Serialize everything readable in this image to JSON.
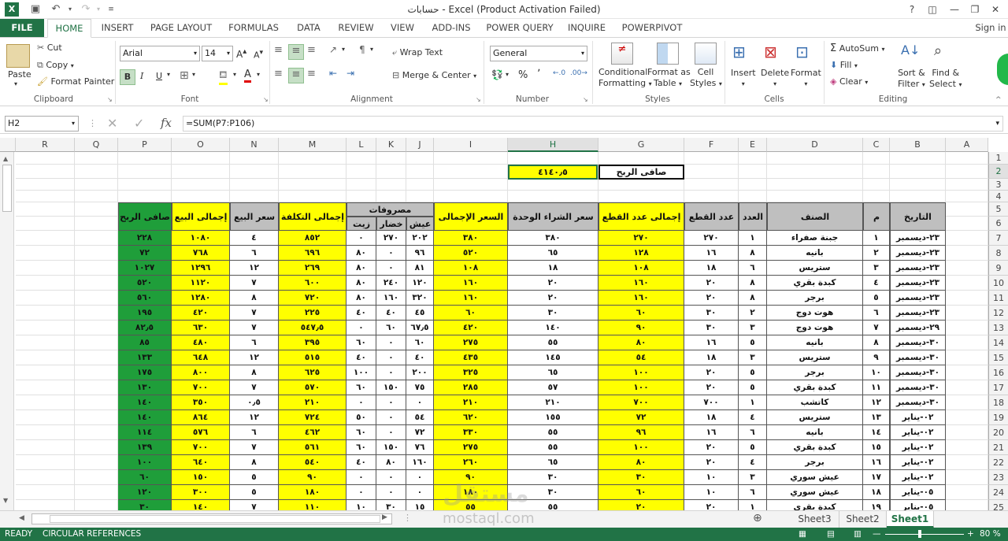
{
  "window": {
    "title": "حسابات - Excel (Product Activation Failed)",
    "help": "?",
    "signin": "Sign in"
  },
  "ribbon_tabs": [
    "FILE",
    "HOME",
    "INSERT",
    "PAGE LAYOUT",
    "FORMULAS",
    "DATA",
    "REVIEW",
    "VIEW",
    "ADD-INS",
    "POWER QUERY",
    "INQUIRE",
    "POWERPIVOT"
  ],
  "clipboard": {
    "paste": "Paste",
    "cut": "Cut",
    "copy": "Copy",
    "format_painter": "Format Painter",
    "label": "Clipboard"
  },
  "font": {
    "name": "Arial",
    "size": "14",
    "label": "Font",
    "bold": "B",
    "italic": "I",
    "underline": "U"
  },
  "alignment": {
    "wrap": "Wrap Text",
    "merge": "Merge & Center",
    "label": "Alignment"
  },
  "number": {
    "format": "General",
    "pct": "%",
    "comma": "٬",
    "label": "Number"
  },
  "styles": {
    "conditional": "Conditional",
    "conditional2": "Formatting",
    "format_as": "Format as",
    "format_as2": "Table",
    "cell": "Cell",
    "cell2": "Styles",
    "label": "Styles"
  },
  "cells": {
    "insert": "Insert",
    "delete": "Delete",
    "format": "Format",
    "label": "Cells"
  },
  "editing": {
    "autosum": "AutoSum",
    "fill": "Fill",
    "clear": "Clear",
    "sort": "Sort &",
    "sort2": "Filter",
    "find": "Find &",
    "find2": "Select",
    "label": "Editing"
  },
  "formula_bar": {
    "name_box": "H2",
    "formula": "=SUM(P7:P106)",
    "fx": "fx"
  },
  "columns": [
    "R",
    "Q",
    "P",
    "O",
    "N",
    "M",
    "L",
    "K",
    "J",
    "I",
    "H",
    "G",
    "F",
    "E",
    "D",
    "C",
    "B",
    "A"
  ],
  "rows": [
    "1",
    "2",
    "3",
    "4",
    "5",
    "6",
    "7",
    "8",
    "9",
    "10",
    "11",
    "12",
    "13",
    "14",
    "15",
    "16",
    "17",
    "18",
    "19",
    "20",
    "21",
    "22",
    "23",
    "24",
    "25"
  ],
  "summary": {
    "label": "صافى الربح",
    "value": "٤١٤٠٫٥"
  },
  "headers": {
    "date": "التاريخ",
    "num": "م",
    "item": "الصنف",
    "count": "العدد",
    "pieces": "عدد القطع",
    "total_pieces": "إجمالى عدد القطع",
    "unit_cost": "سعر الشراء الوحدة",
    "total_price": "السعر  الإجمالى",
    "expenses": "مصروفات",
    "bread": "عيش",
    "veg": "خضار",
    "oil": "زيت",
    "total_cost": "إجمالى التكلفة",
    "sale_price": "سعر البيع",
    "total_sales": "إجمالى البيع",
    "net_profit": "صافى الربح"
  },
  "table_rows": [
    [
      "٢٣-ديسمبر",
      "١",
      "جبنة صفراء",
      "١",
      "٢٧٠",
      "٢٧٠",
      "٣٨٠",
      "٣٨٠",
      "٢٠٢",
      "٢٧٠",
      "٠",
      "٨٥٢",
      "٤",
      "١٠٨٠",
      "٢٢٨"
    ],
    [
      "٢٣-ديسمبر",
      "٢",
      "بانيه",
      "٨",
      "١٦",
      "١٢٨",
      "٦٥",
      "٥٢٠",
      "٩٦",
      "٠",
      "٨٠",
      "٦٩٦",
      "٦",
      "٧٦٨",
      "٧٢"
    ],
    [
      "٢٣-ديسمبر",
      "٣",
      "ستريس",
      "٦",
      "١٨",
      "١٠٨",
      "١٨",
      "١٠٨",
      "٨١",
      "٠",
      "٨٠",
      "٢٦٩",
      "١٢",
      "١٢٩٦",
      "١٠٢٧"
    ],
    [
      "٢٣-ديسمبر",
      "٤",
      "كبدة بقري",
      "٨",
      "٢٠",
      "١٦٠",
      "٢٠",
      "١٦٠",
      "١٢٠",
      "٢٤٠",
      "٨٠",
      "٦٠٠",
      "٧",
      "١١٢٠",
      "٥٢٠"
    ],
    [
      "٢٣-ديسمبر",
      "٥",
      "برجر",
      "٨",
      "٢٠",
      "١٦٠",
      "٢٠",
      "١٦٠",
      "٣٢٠",
      "١٦٠",
      "٨٠",
      "٧٢٠",
      "٨",
      "١٢٨٠",
      "٥٦٠"
    ],
    [
      "٢٣-ديسمبر",
      "٦",
      "هوت دوج",
      "٢",
      "٣٠",
      "٦٠",
      "٣٠",
      "٦٠",
      "٤٥",
      "٤٠",
      "٤٠",
      "٢٢٥",
      "٧",
      "٤٢٠",
      "١٩٥"
    ],
    [
      "٢٩-ديسمبر",
      "٧",
      "هوت دوج",
      "٣",
      "٣٠",
      "٩٠",
      "١٤٠",
      "٤٢٠",
      "٦٧٫٥",
      "٦٠",
      "٠",
      "٥٤٧٫٥",
      "٧",
      "٦٣٠",
      "٨٢٫٥"
    ],
    [
      "٣٠-ديسمبر",
      "٨",
      "بانيه",
      "٥",
      "١٦",
      "٨٠",
      "٥٥",
      "٢٧٥",
      "٦٠",
      "٠",
      "٦٠",
      "٣٩٥",
      "٦",
      "٤٨٠",
      "٨٥"
    ],
    [
      "٣٠-ديسمبر",
      "٩",
      "ستريس",
      "٣",
      "١٨",
      "٥٤",
      "١٤٥",
      "٤٣٥",
      "٤٠",
      "٠",
      "٤٠",
      "٥١٥",
      "١٢",
      "٦٤٨",
      "١٣٣"
    ],
    [
      "٣٠-ديسمبر",
      "١٠",
      "برجر",
      "٥",
      "٢٠",
      "١٠٠",
      "٦٥",
      "٣٢٥",
      "٢٠٠",
      "٠",
      "١٠٠",
      "٦٢٥",
      "٨",
      "٨٠٠",
      "١٧٥"
    ],
    [
      "٣٠-ديسمبر",
      "١١",
      "كبدة بقري",
      "٥",
      "٢٠",
      "١٠٠",
      "٥٧",
      "٢٨٥",
      "٧٥",
      "١٥٠",
      "٦٠",
      "٥٧٠",
      "٧",
      "٧٠٠",
      "١٣٠"
    ],
    [
      "٣٠-ديسمبر",
      "١٢",
      "كاتشب",
      "١",
      "٧٠٠",
      "٧٠٠",
      "٢١٠",
      "٢١٠",
      "٠",
      "٠",
      "٠",
      "٢١٠",
      "٠٫٥",
      "٣٥٠",
      "١٤٠"
    ],
    [
      "٠٢-يناير",
      "١٣",
      "ستريس",
      "٤",
      "١٨",
      "٧٢",
      "١٥٥",
      "٦٢٠",
      "٥٤",
      "٠",
      "٥٠",
      "٧٢٤",
      "١٢",
      "٨٦٤",
      "١٤٠"
    ],
    [
      "٠٢-يناير",
      "١٤",
      "بانيه",
      "٦",
      "١٦",
      "٩٦",
      "٥٥",
      "٣٣٠",
      "٧٢",
      "٠",
      "٦٠",
      "٤٦٢",
      "٦",
      "٥٧٦",
      "١١٤"
    ],
    [
      "٠٢-يناير",
      "١٥",
      "كبدة بقري",
      "٥",
      "٢٠",
      "١٠٠",
      "٥٥",
      "٢٧٥",
      "٧٦",
      "١٥٠",
      "٦٠",
      "٥٦١",
      "٧",
      "٧٠٠",
      "١٣٩"
    ],
    [
      "٠٢-يناير",
      "١٦",
      "برجر",
      "٤",
      "٢٠",
      "٨٠",
      "٦٥",
      "٢٦٠",
      "١٦٠",
      "٨٠",
      "٤٠",
      "٥٤٠",
      "٨",
      "٦٤٠",
      "١٠٠"
    ],
    [
      "٠٢-يناير",
      "١٧",
      "عيش سوري",
      "٣",
      "١٠",
      "٣٠",
      "٣٠",
      "٩٠",
      "٠",
      "٠",
      "٠",
      "٩٠",
      "٥",
      "١٥٠",
      "٦٠"
    ],
    [
      "٠٥-يناير",
      "١٨",
      "عيش سوري",
      "٦",
      "١٠",
      "٦٠",
      "٣٠",
      "١٨٠",
      "٠",
      "٠",
      "٠",
      "١٨٠",
      "٥",
      "٣٠٠",
      "١٢٠"
    ],
    [
      "٠٥-يناير",
      "١٩",
      "كبدة بقري",
      "١",
      "٢٠",
      "٢٠",
      "٥٥",
      "٥٥",
      "١٥",
      "٣٠",
      "١٠",
      "١١٠",
      "٧",
      "١٤٠",
      "٣٠"
    ]
  ],
  "sheets": [
    "Sheet3",
    "Sheet2",
    "Sheet1"
  ],
  "status": {
    "ready": "READY",
    "circular": "CIRCULAR REFERENCES",
    "zoom": "80 %"
  },
  "watermark": {
    "text": "مستقل",
    "url": "mostaql.com"
  },
  "colors": {
    "excel_green": "#217346",
    "yellow": "#ffff00",
    "green_cell": "#1f9e3a",
    "gray_header": "#bfbfbf"
  }
}
